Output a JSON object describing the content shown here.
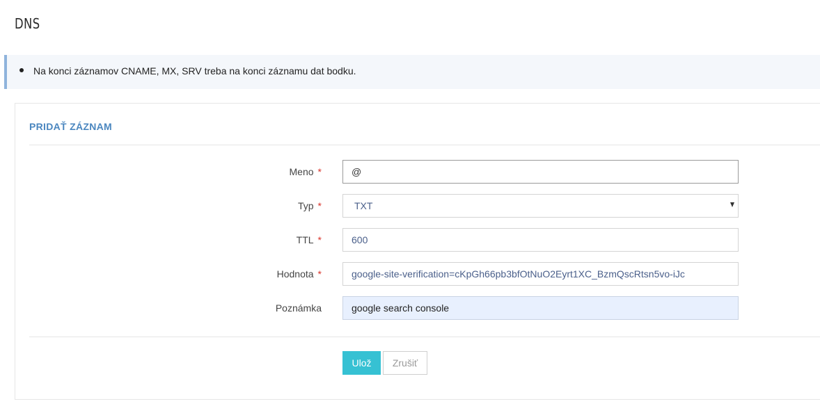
{
  "page": {
    "title": "DNS"
  },
  "notice": {
    "items": [
      "Na konci záznamov CNAME, MX, SRV treba na konci záznamu dat bodku."
    ]
  },
  "form": {
    "title": "PRIDAŤ ZÁZNAM",
    "required_mark": "*",
    "fields": {
      "name": {
        "label": "Meno",
        "value": "@"
      },
      "type": {
        "label": "Typ",
        "value": "TXT",
        "options": [
          "TXT"
        ]
      },
      "ttl": {
        "label": "TTL",
        "value": "600"
      },
      "value": {
        "label": "Hodnota",
        "value": "google-site-verification=cKpGh66pb3bfOtNuO2Eyrt1XC_BzmQscRtsn5vo-iJc"
      },
      "note": {
        "label": "Poznámka",
        "value": "google search console"
      }
    },
    "buttons": {
      "save": "Ulož",
      "cancel": "Zrušiť"
    }
  },
  "colors": {
    "accent": "#36c1d3",
    "title": "#4a86bf",
    "notice_border": "#8fb4dc",
    "required": "#d9342b",
    "autofill": "#e8f0fe"
  }
}
